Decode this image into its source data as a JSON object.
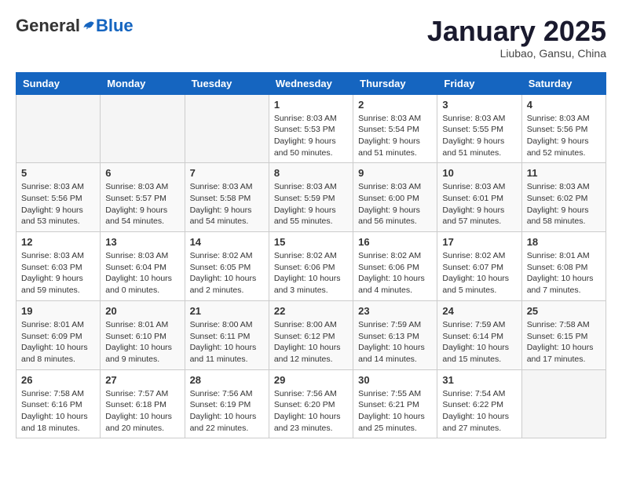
{
  "logo": {
    "general": "General",
    "blue": "Blue"
  },
  "title": "January 2025",
  "subtitle": "Liubao, Gansu, China",
  "days_of_week": [
    "Sunday",
    "Monday",
    "Tuesday",
    "Wednesday",
    "Thursday",
    "Friday",
    "Saturday"
  ],
  "weeks": [
    [
      {
        "day": "",
        "info": ""
      },
      {
        "day": "",
        "info": ""
      },
      {
        "day": "",
        "info": ""
      },
      {
        "day": "1",
        "info": "Sunrise: 8:03 AM\nSunset: 5:53 PM\nDaylight: 9 hours\nand 50 minutes."
      },
      {
        "day": "2",
        "info": "Sunrise: 8:03 AM\nSunset: 5:54 PM\nDaylight: 9 hours\nand 51 minutes."
      },
      {
        "day": "3",
        "info": "Sunrise: 8:03 AM\nSunset: 5:55 PM\nDaylight: 9 hours\nand 51 minutes."
      },
      {
        "day": "4",
        "info": "Sunrise: 8:03 AM\nSunset: 5:56 PM\nDaylight: 9 hours\nand 52 minutes."
      }
    ],
    [
      {
        "day": "5",
        "info": "Sunrise: 8:03 AM\nSunset: 5:56 PM\nDaylight: 9 hours\nand 53 minutes."
      },
      {
        "day": "6",
        "info": "Sunrise: 8:03 AM\nSunset: 5:57 PM\nDaylight: 9 hours\nand 54 minutes."
      },
      {
        "day": "7",
        "info": "Sunrise: 8:03 AM\nSunset: 5:58 PM\nDaylight: 9 hours\nand 54 minutes."
      },
      {
        "day": "8",
        "info": "Sunrise: 8:03 AM\nSunset: 5:59 PM\nDaylight: 9 hours\nand 55 minutes."
      },
      {
        "day": "9",
        "info": "Sunrise: 8:03 AM\nSunset: 6:00 PM\nDaylight: 9 hours\nand 56 minutes."
      },
      {
        "day": "10",
        "info": "Sunrise: 8:03 AM\nSunset: 6:01 PM\nDaylight: 9 hours\nand 57 minutes."
      },
      {
        "day": "11",
        "info": "Sunrise: 8:03 AM\nSunset: 6:02 PM\nDaylight: 9 hours\nand 58 minutes."
      }
    ],
    [
      {
        "day": "12",
        "info": "Sunrise: 8:03 AM\nSunset: 6:03 PM\nDaylight: 9 hours\nand 59 minutes."
      },
      {
        "day": "13",
        "info": "Sunrise: 8:03 AM\nSunset: 6:04 PM\nDaylight: 10 hours\nand 0 minutes."
      },
      {
        "day": "14",
        "info": "Sunrise: 8:02 AM\nSunset: 6:05 PM\nDaylight: 10 hours\nand 2 minutes."
      },
      {
        "day": "15",
        "info": "Sunrise: 8:02 AM\nSunset: 6:06 PM\nDaylight: 10 hours\nand 3 minutes."
      },
      {
        "day": "16",
        "info": "Sunrise: 8:02 AM\nSunset: 6:06 PM\nDaylight: 10 hours\nand 4 minutes."
      },
      {
        "day": "17",
        "info": "Sunrise: 8:02 AM\nSunset: 6:07 PM\nDaylight: 10 hours\nand 5 minutes."
      },
      {
        "day": "18",
        "info": "Sunrise: 8:01 AM\nSunset: 6:08 PM\nDaylight: 10 hours\nand 7 minutes."
      }
    ],
    [
      {
        "day": "19",
        "info": "Sunrise: 8:01 AM\nSunset: 6:09 PM\nDaylight: 10 hours\nand 8 minutes."
      },
      {
        "day": "20",
        "info": "Sunrise: 8:01 AM\nSunset: 6:10 PM\nDaylight: 10 hours\nand 9 minutes."
      },
      {
        "day": "21",
        "info": "Sunrise: 8:00 AM\nSunset: 6:11 PM\nDaylight: 10 hours\nand 11 minutes."
      },
      {
        "day": "22",
        "info": "Sunrise: 8:00 AM\nSunset: 6:12 PM\nDaylight: 10 hours\nand 12 minutes."
      },
      {
        "day": "23",
        "info": "Sunrise: 7:59 AM\nSunset: 6:13 PM\nDaylight: 10 hours\nand 14 minutes."
      },
      {
        "day": "24",
        "info": "Sunrise: 7:59 AM\nSunset: 6:14 PM\nDaylight: 10 hours\nand 15 minutes."
      },
      {
        "day": "25",
        "info": "Sunrise: 7:58 AM\nSunset: 6:15 PM\nDaylight: 10 hours\nand 17 minutes."
      }
    ],
    [
      {
        "day": "26",
        "info": "Sunrise: 7:58 AM\nSunset: 6:16 PM\nDaylight: 10 hours\nand 18 minutes."
      },
      {
        "day": "27",
        "info": "Sunrise: 7:57 AM\nSunset: 6:18 PM\nDaylight: 10 hours\nand 20 minutes."
      },
      {
        "day": "28",
        "info": "Sunrise: 7:56 AM\nSunset: 6:19 PM\nDaylight: 10 hours\nand 22 minutes."
      },
      {
        "day": "29",
        "info": "Sunrise: 7:56 AM\nSunset: 6:20 PM\nDaylight: 10 hours\nand 23 minutes."
      },
      {
        "day": "30",
        "info": "Sunrise: 7:55 AM\nSunset: 6:21 PM\nDaylight: 10 hours\nand 25 minutes."
      },
      {
        "day": "31",
        "info": "Sunrise: 7:54 AM\nSunset: 6:22 PM\nDaylight: 10 hours\nand 27 minutes."
      },
      {
        "day": "",
        "info": ""
      }
    ]
  ]
}
